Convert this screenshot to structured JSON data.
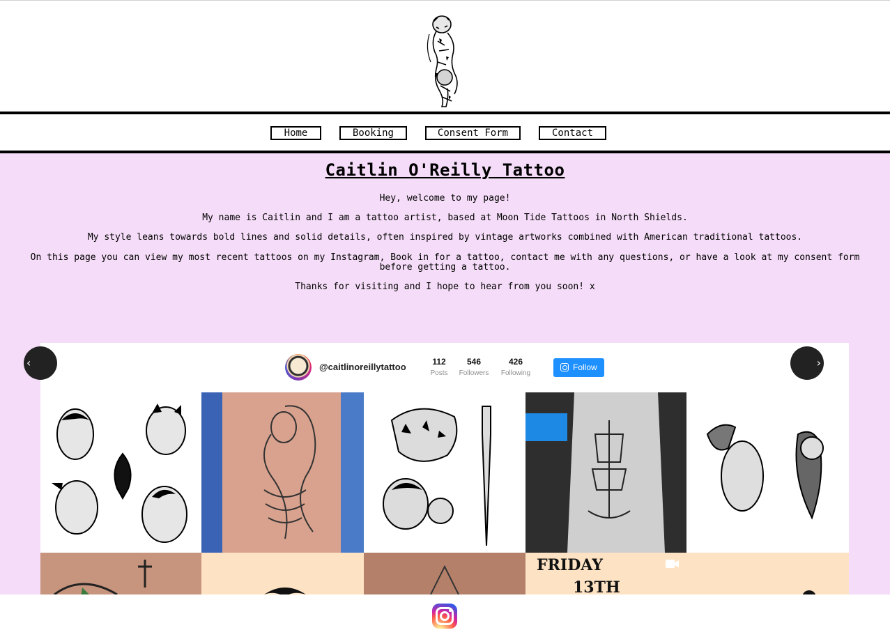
{
  "nav": {
    "items": [
      {
        "label": "Home"
      },
      {
        "label": "Booking"
      },
      {
        "label": "Consent Form"
      },
      {
        "label": "Contact"
      }
    ]
  },
  "main": {
    "title": "Caitlin O'Reilly Tattoo",
    "paragraphs": [
      "Hey, welcome to my page!",
      "My name is Caitlin and I am a tattoo artist, based at Moon Tide Tattoos in North Shields.",
      "My style leans towards bold lines and solid details, often inspired by vintage artworks combined with American traditional tattoos.",
      "On this page you can view my most recent tattoos on my Instagram, Book in for a tattoo, contact me with any questions, or have a look at my consent form before getting a tattoo.",
      "Thanks for visiting and I hope to hear from you soon! x"
    ],
    "background": "#f5dcf8"
  },
  "instagram": {
    "handle": "@caitlinoreillytattoo",
    "stats": [
      {
        "value": "112",
        "label": "Posts"
      },
      {
        "value": "546",
        "label": "Followers"
      },
      {
        "value": "426",
        "label": "Following"
      }
    ],
    "follow_label": "Follow",
    "follow_color": "#1e90ff",
    "tile_text": {
      "friday": "FRIDAY",
      "thirteenth": "13TH"
    },
    "prev_icon": "chevron-left-icon",
    "next_icon": "chevron-right-icon"
  },
  "footer": {
    "icon": "instagram-icon"
  }
}
